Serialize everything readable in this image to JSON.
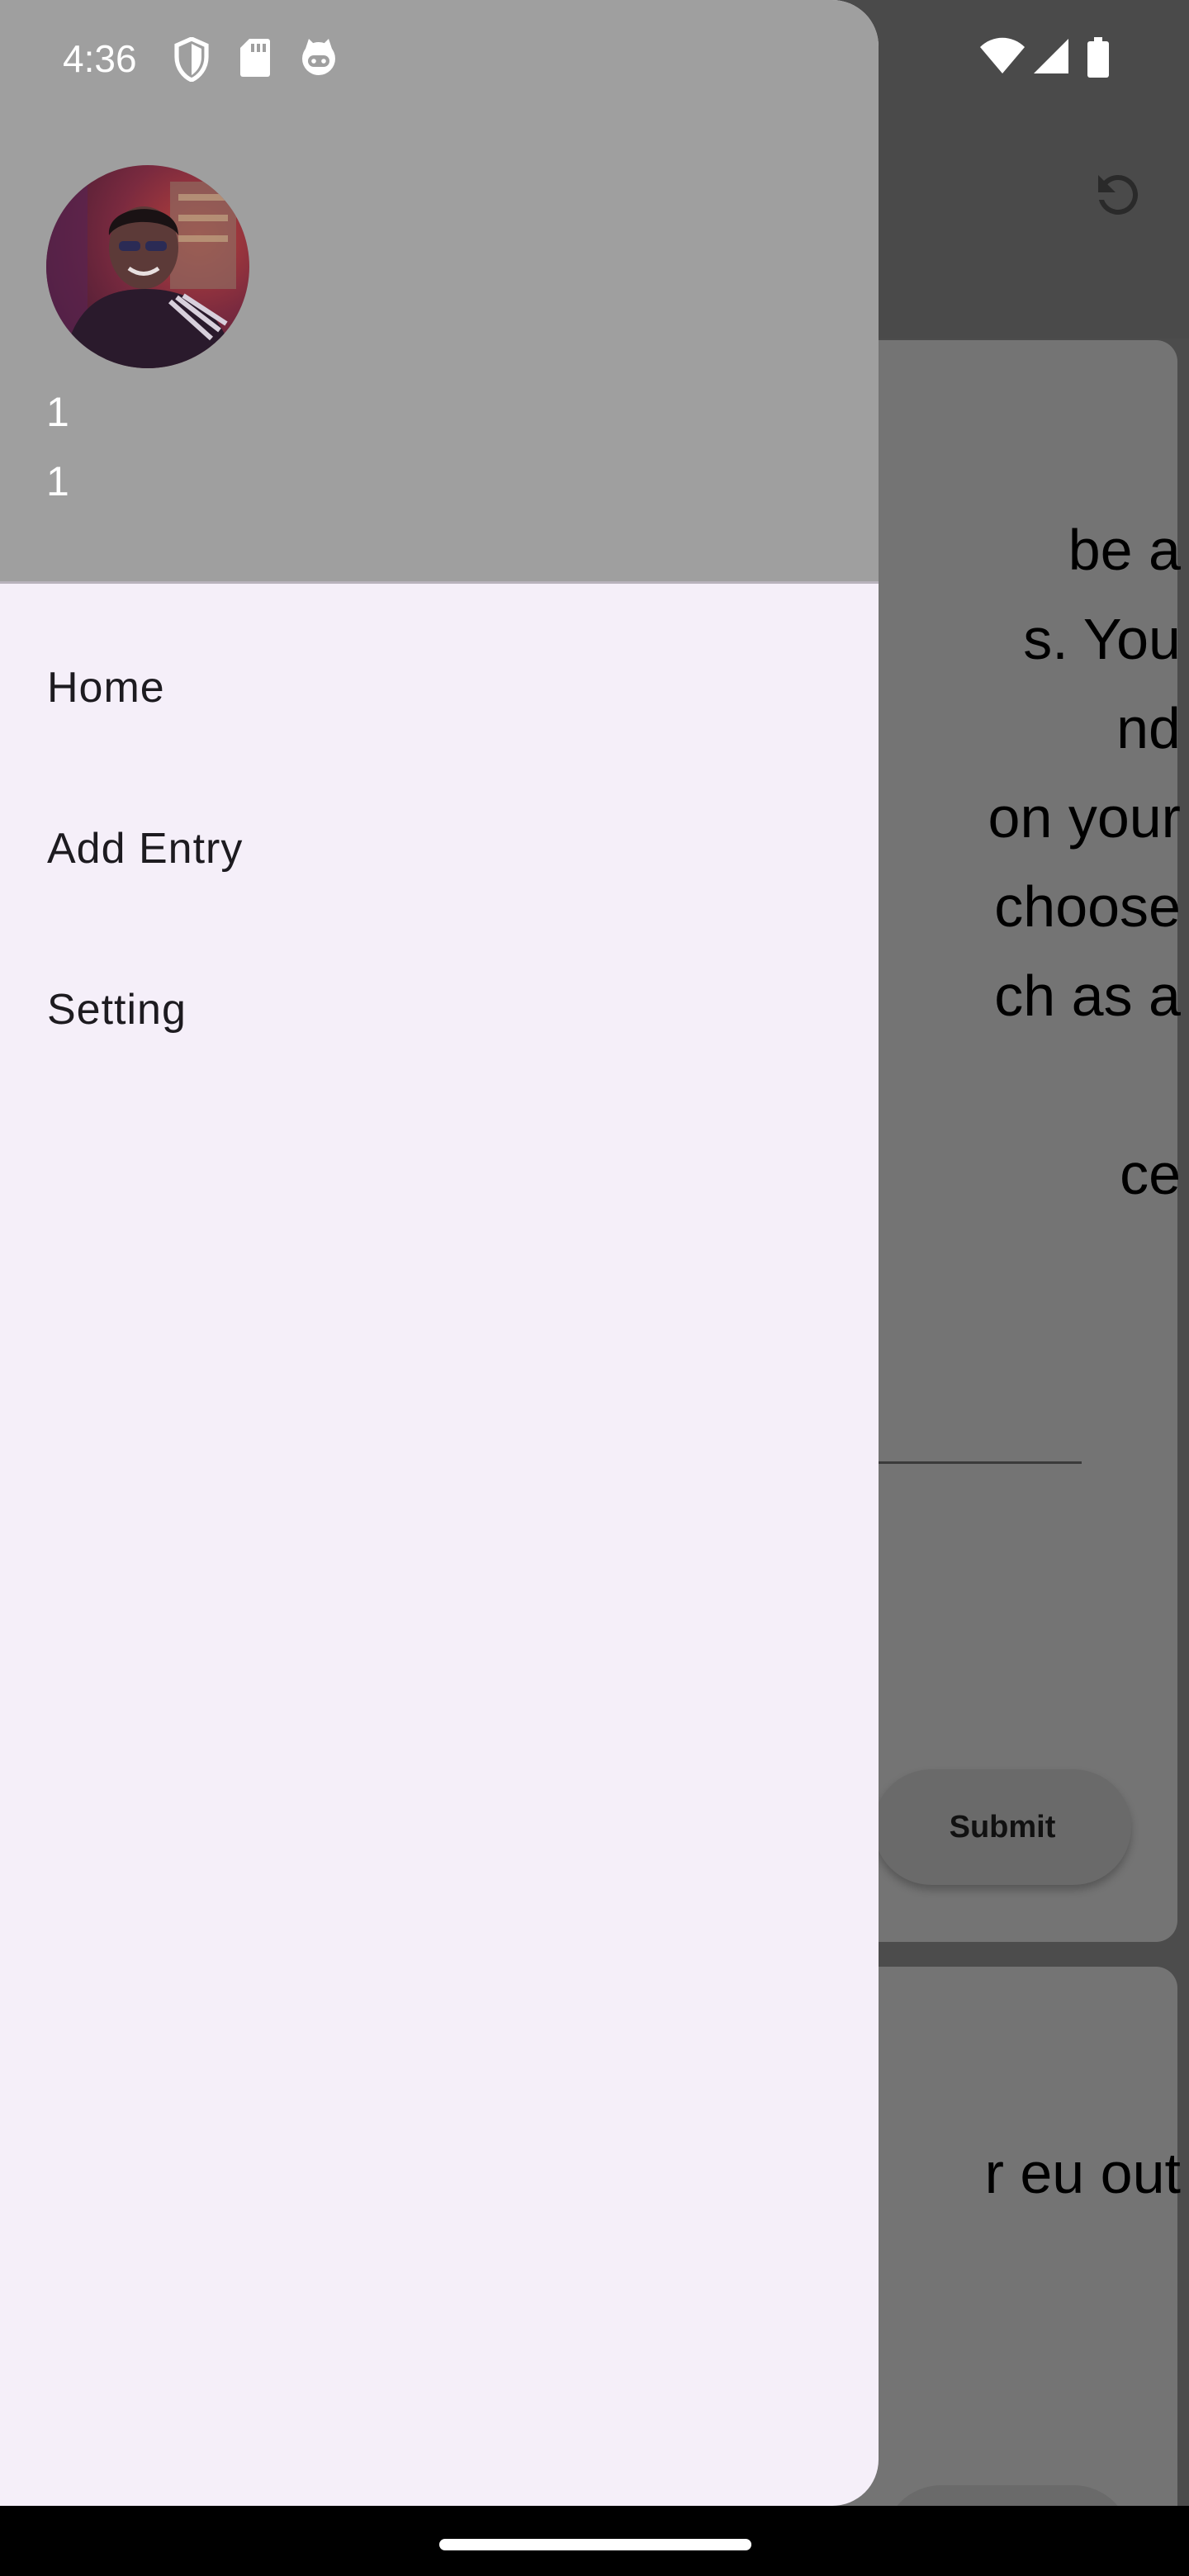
{
  "status_bar": {
    "time": "4:36",
    "icons_left": [
      "shield-icon",
      "sd-card-icon",
      "cat-icon"
    ],
    "icons_right": [
      "wifi-icon",
      "signal-icon",
      "battery-icon"
    ]
  },
  "background": {
    "app_bar": {
      "action_icon": "refresh-icon"
    },
    "card1": {
      "text_lines": [
        "be a",
        "s. You",
        "nd",
        "on your",
        "choose",
        "ch as a",
        "",
        "ce"
      ],
      "submit_label": "Submit"
    },
    "card2": {
      "text_lines": [
        "r eu out"
      ]
    }
  },
  "drawer": {
    "header": {
      "line1": "1",
      "line2": "1"
    },
    "items": [
      {
        "label": "Home"
      },
      {
        "label": "Add Entry"
      },
      {
        "label": "Setting"
      }
    ]
  },
  "colors": {
    "drawer_bg": "#f5eff9",
    "header_bg": "#9f9f9f",
    "scrim_bg": "#4c4c4c",
    "card_bg": "#747474"
  }
}
